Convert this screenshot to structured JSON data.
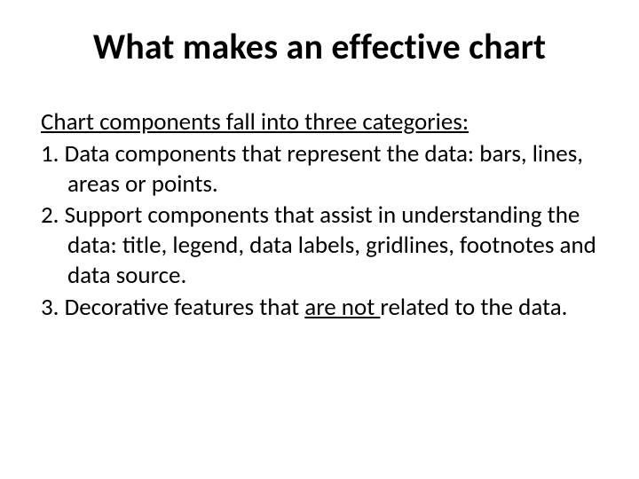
{
  "title": "What makes an effective chart",
  "intro": "Chart components fall into three categories:",
  "items": {
    "one_number": "1. ",
    "one_text": "Data components that represent the data: bars, lines, areas or points.",
    "two_number": "2. ",
    "two_text": "Support components that assist in understanding the data: title, legend, data labels, gridlines, footnotes and data source.",
    "three_number": "3. ",
    "three_prefix": "Decorative features that ",
    "three_underlined": "are not ",
    "three_suffix": "related to the data."
  }
}
